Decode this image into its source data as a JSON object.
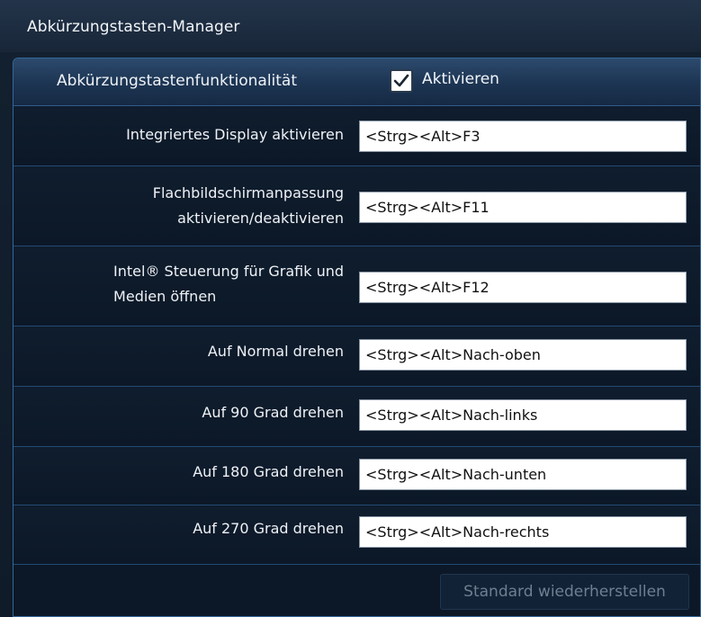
{
  "window": {
    "title": "Abkürzungstasten-Manager"
  },
  "functionality": {
    "label": "Abkürzungstastenfunktionalität",
    "checkbox_label": "Aktivieren",
    "checked": true
  },
  "shortcuts": [
    {
      "label": "Integriertes Display aktivieren",
      "value": "<Strg><Alt>F3"
    },
    {
      "label_line1": "Flachbildschirmanpassung",
      "label_line2": "aktivieren/deaktivieren",
      "value": "<Strg><Alt>F11"
    },
    {
      "label_line1": "Intel® Steuerung für Grafik und",
      "label_line2": "Medien öffnen",
      "value": "<Strg><Alt>F12"
    },
    {
      "label": "Auf Normal drehen",
      "value": "<Strg><Alt>Nach-oben"
    },
    {
      "label": "Auf 90 Grad drehen",
      "value": "<Strg><Alt>Nach-links"
    },
    {
      "label": "Auf 180 Grad drehen",
      "value": "<Strg><Alt>Nach-unten"
    },
    {
      "label": "Auf 270 Grad drehen",
      "value": "<Strg><Alt>Nach-rechts"
    }
  ],
  "footer": {
    "restore_label": "Standard wiederherstellen"
  },
  "colors": {
    "accent_border": "#34679b",
    "disabled_text": "#6f7f91"
  },
  "icons": {
    "checkbox": "check-icon"
  }
}
